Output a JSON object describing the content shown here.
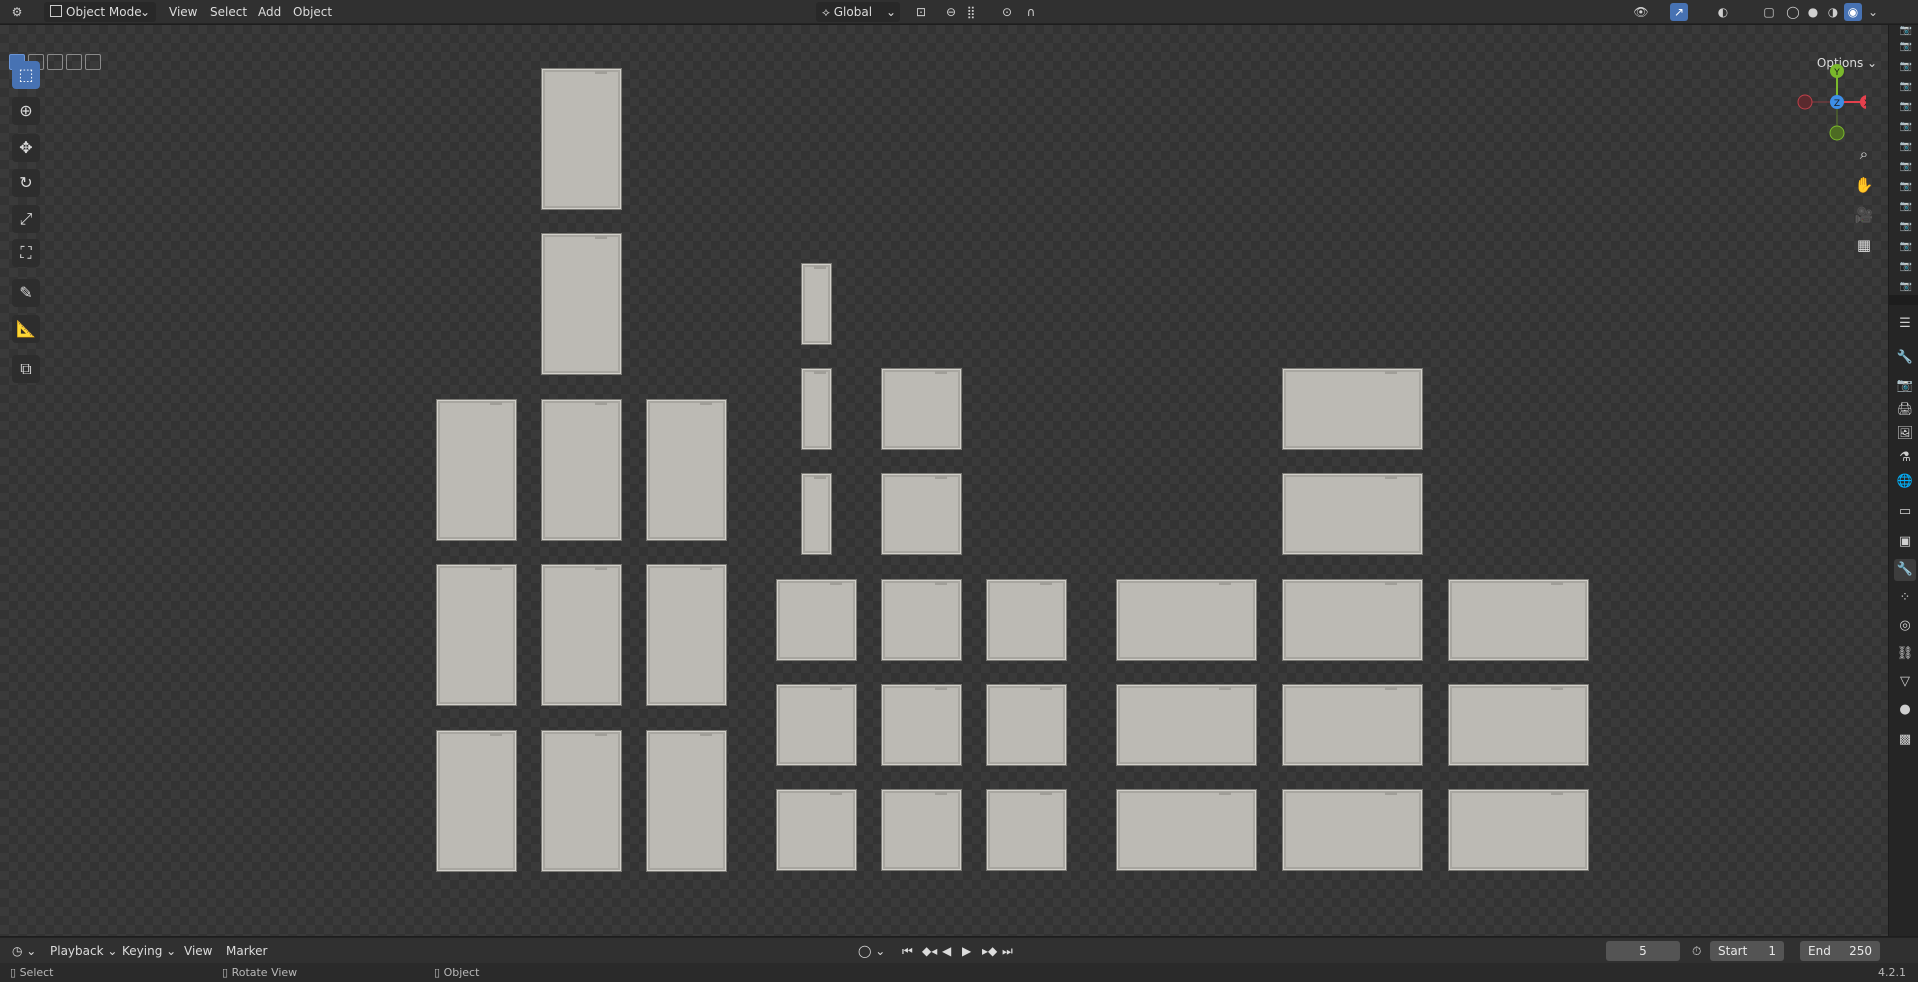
{
  "header": {
    "editor_icon": "3d-viewport-icon",
    "mode": "Object Mode",
    "menus": [
      "View",
      "Select",
      "Add",
      "Object"
    ],
    "transform_orientation": "Global"
  },
  "viewport": {
    "options_label": "Options",
    "gizmo": {
      "y": "Y",
      "x": "X",
      "z": "Z"
    }
  },
  "toolbar": {
    "tools": [
      "select-box-icon",
      "cursor-icon",
      "move-icon",
      "rotate-icon",
      "scale-icon",
      "transform-icon",
      "annotate-icon",
      "measure-icon",
      "add-cube-icon"
    ]
  },
  "timeline": {
    "menus": [
      "Playback",
      "Keying",
      "View",
      "Marker"
    ],
    "current_frame": "5",
    "start_label": "Start",
    "start_value": "1",
    "end_label": "End",
    "end_value": "250"
  },
  "statusbar": {
    "select": "Select",
    "rotate_view": "Rotate View",
    "object": "Object",
    "version": "4.2.1"
  },
  "colors": {
    "accent": "#4772b3",
    "axis_x": "#e5404d",
    "axis_y": "#7ab82b",
    "axis_z": "#3d8ee6"
  }
}
